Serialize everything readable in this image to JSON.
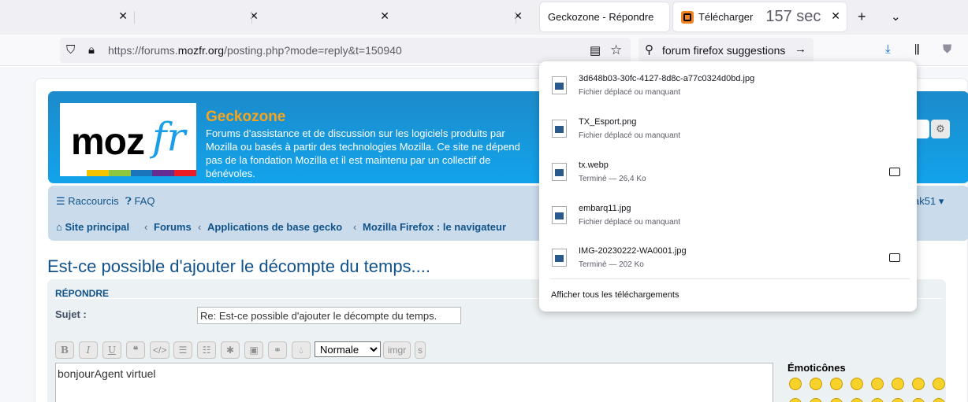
{
  "tabs": [
    {
      "label": ""
    },
    {
      "label": ""
    },
    {
      "label": ""
    },
    {
      "label": ""
    },
    {
      "label": "Geckozone - Répondre"
    },
    {
      "label": "Télécharger",
      "badge": "157 sec"
    }
  ],
  "address": {
    "prefix": "https://forums.",
    "domain": "mozfr.org",
    "suffix": "/posting.php?mode=reply&t=150940"
  },
  "search": {
    "query": "forum firefox suggestions"
  },
  "site": {
    "logo_text": "moz",
    "logo_accent": "fr",
    "name": "Geckozone",
    "description": "Forums d'assistance et de discussion sur les logiciels produits par Mozilla ou basés à partir des technologies Mozilla. Ce site ne dépend pas de la fondation Mozilla et il est maintenu par un collectif de bénévoles."
  },
  "nav": {
    "shortcuts": "Raccourcis",
    "faq": "FAQ",
    "user": "ak51",
    "breadcrumbs": [
      "Site principal",
      "Forums",
      "Applications de base gecko",
      "Mozilla Firefox : le navigateur"
    ]
  },
  "topic_title": "Est-ce possible d'ajouter le décompte du temps....",
  "post": {
    "heading": "RÉPONDRE",
    "subject_label": "Sujet :",
    "subject_value": "Re: Est-ce possible d'ajouter le décompte du temps.",
    "size_option": "Normale",
    "imgr_label": "imgr",
    "s_label": "s",
    "message": "bonjourAgent virtuel",
    "smileys_title": "Émoticônes"
  },
  "downloads": {
    "items": [
      {
        "name": "3d648b03-30fc-4127-8d8c-a77c0324d0bd.jpg",
        "status": "Fichier déplacé ou manquant",
        "folder": false
      },
      {
        "name": "TX_Esport.png",
        "status": "Fichier déplacé ou manquant",
        "folder": false
      },
      {
        "name": "tx.webp",
        "status": "Terminé — 26,4 Ko",
        "folder": true
      },
      {
        "name": "embarq11.jpg",
        "status": "Fichier déplacé ou manquant",
        "folder": false
      },
      {
        "name": "IMG-20230222-WA0001.jpg",
        "status": "Terminé — 202 Ko",
        "folder": true
      }
    ],
    "show_all": "Afficher tous les téléchargements"
  },
  "colors": {
    "accent": "#1c8bcb",
    "title": "#105289",
    "brand_orange": "#f7a51c"
  },
  "icons": [
    "close-icon",
    "plus-icon",
    "chevron-down-icon",
    "shield-icon",
    "lock-icon",
    "reader-icon",
    "star-icon",
    "search-icon",
    "arrow-right-icon",
    "download-icon",
    "library-icon",
    "account-icon",
    "home-icon",
    "question-icon",
    "menu-icon",
    "gear-icon",
    "folder-icon",
    "image-file-icon"
  ]
}
